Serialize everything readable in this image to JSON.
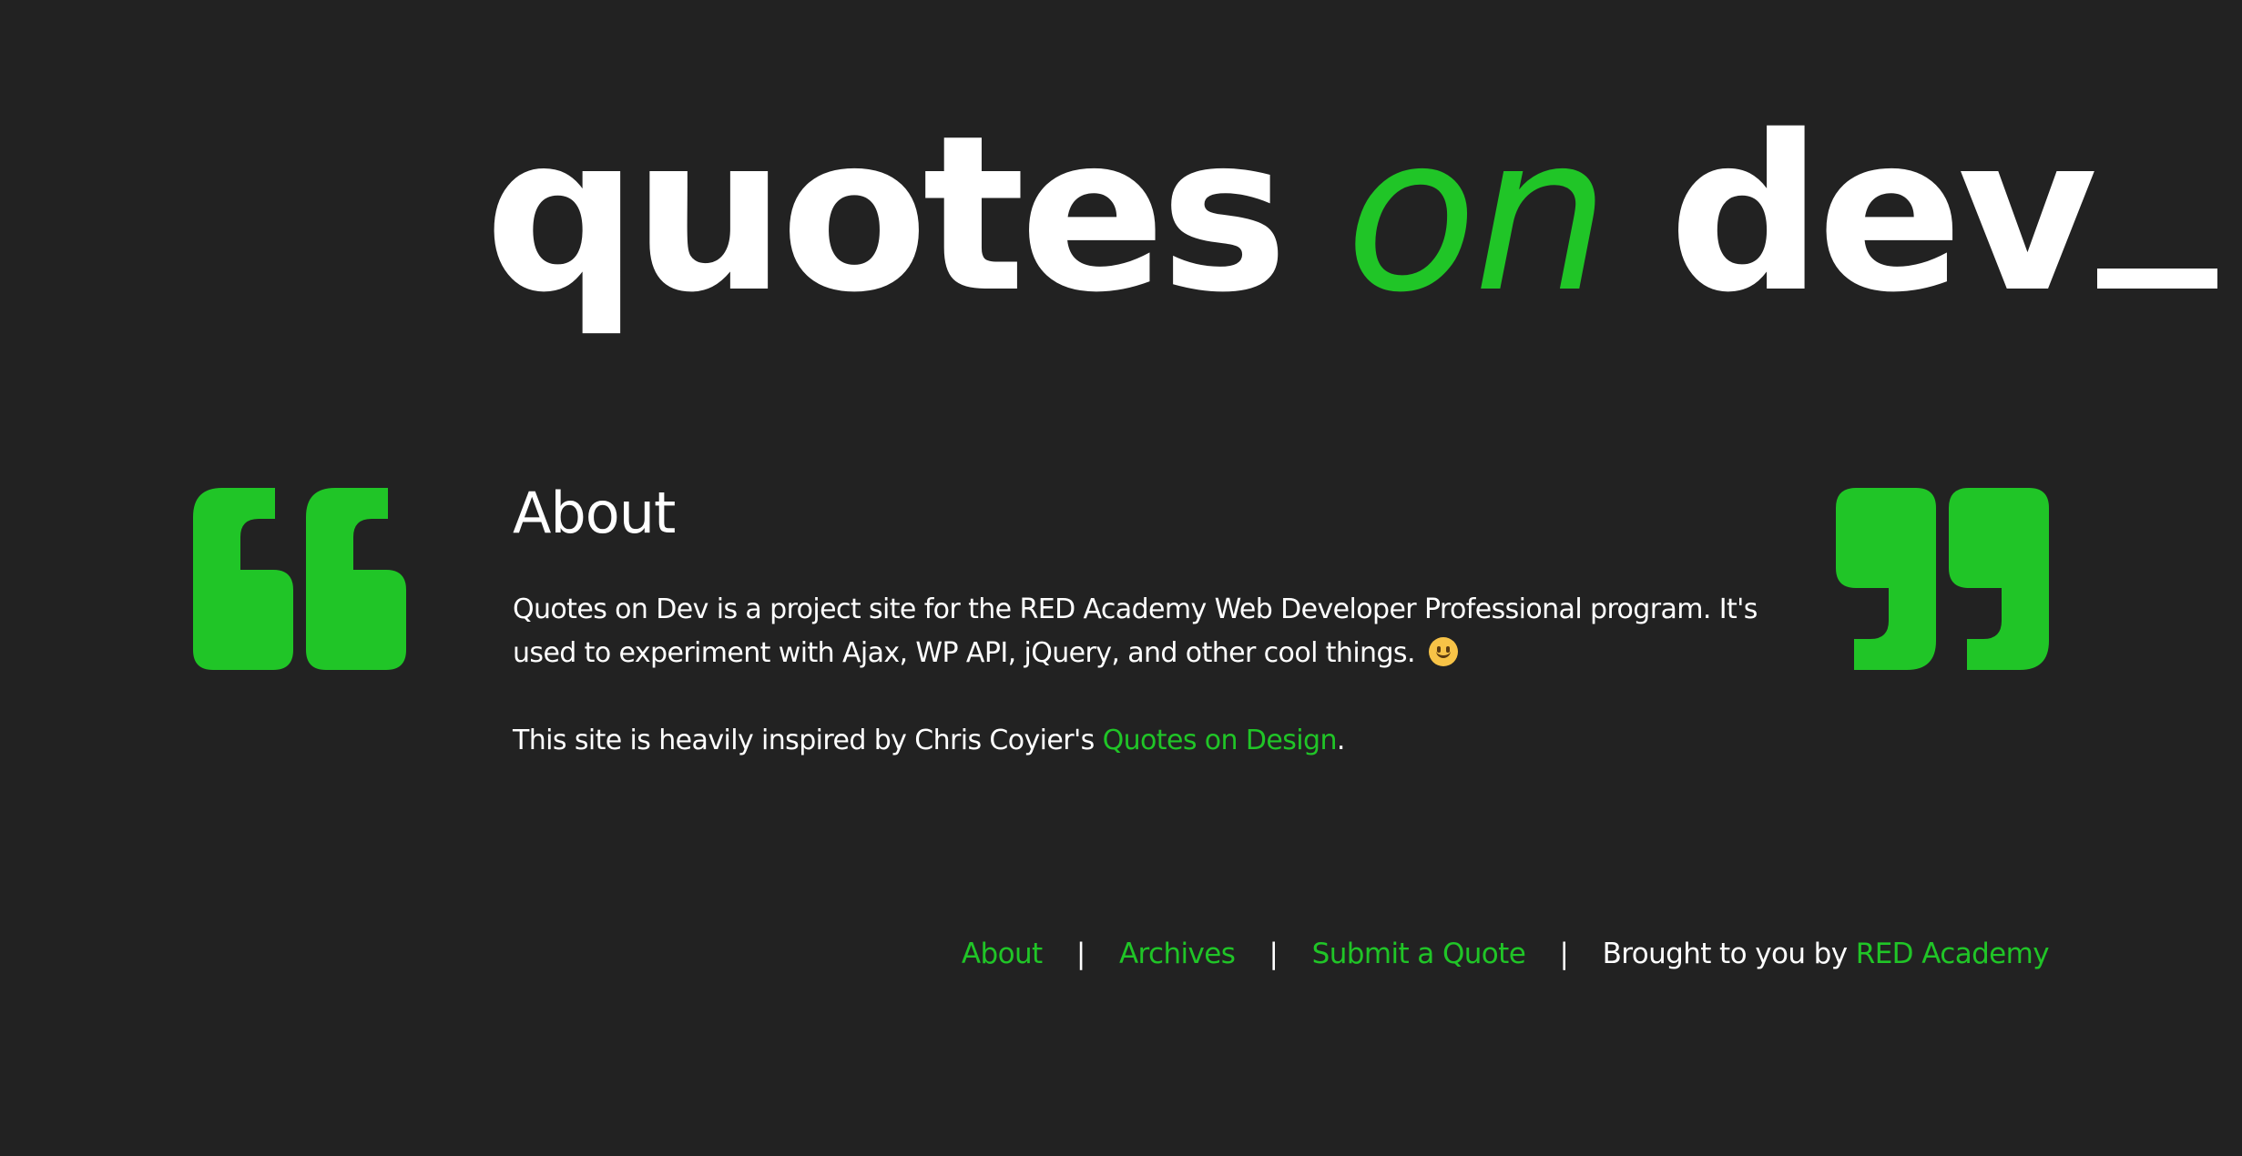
{
  "logo": {
    "word1": "quotes",
    "word2": "on",
    "word3": "dev"
  },
  "icons": {
    "left": "open-quote-icon",
    "right": "close-quote-icon",
    "emoji": "smiley-emoji-icon"
  },
  "colors": {
    "background": "#222222",
    "accent": "#20c527",
    "text": "#ffffff"
  },
  "main": {
    "title": "About",
    "paragraph1": "Quotes on Dev is a project site for the RED Academy Web Developer Professional program. It's used to experiment with Ajax, WP API, jQuery, and other cool things.",
    "paragraph2_prefix": "This site is heavily inspired by Chris Coyier's",
    "paragraph2_link": "Quotes on Design",
    "paragraph2_suffix": "."
  },
  "footer": {
    "links": [
      "About",
      "Archives",
      "Submit a Quote"
    ],
    "separator": "|",
    "credit_prefix": "Brought to you by",
    "credit_link": "RED Academy"
  }
}
